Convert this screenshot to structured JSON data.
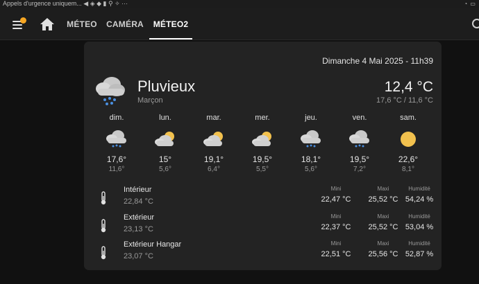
{
  "statusbar": {
    "text": "Appels d'urgence uniquem... ◀ ◈ ◆ ▮ ⚲ ✧ ···",
    "icons": "◔ ▭"
  },
  "nav": {
    "tabs": [
      {
        "label": "MÉTEO"
      },
      {
        "label": "CAMÉRA"
      },
      {
        "label": "MÉTEO2"
      }
    ],
    "active_tab": "MÉTEO2",
    "accent_dot_color": "#f6a623"
  },
  "weather": {
    "datetime": "Dimanche 4 Mai 2025 - 11h39",
    "condition": "Pluvieux",
    "location": "Marçon",
    "temperature": "12,4 °C",
    "range": "17,6 °C / 11,6 °C",
    "icon": "rainy-icon"
  },
  "forecast": [
    {
      "day": "dim.",
      "high": "17,6°",
      "low": "11,6°",
      "icon": "rainy-icon"
    },
    {
      "day": "lun.",
      "high": "15°",
      "low": "5,6°",
      "icon": "partly-cloudy-icon"
    },
    {
      "day": "mar.",
      "high": "19,1°",
      "low": "6,4°",
      "icon": "partly-cloudy-icon"
    },
    {
      "day": "mer.",
      "high": "19,5°",
      "low": "5,5°",
      "icon": "partly-cloudy-icon"
    },
    {
      "day": "jeu.",
      "high": "18,1°",
      "low": "5,6°",
      "icon": "rainy-icon"
    },
    {
      "day": "ven.",
      "high": "19,5°",
      "low": "7,2°",
      "icon": "rainy-icon"
    },
    {
      "day": "sam.",
      "high": "22,6°",
      "low": "8,1°",
      "icon": "sunny-icon"
    }
  ],
  "sensors": {
    "labels": {
      "min": "Mini",
      "max": "Maxi",
      "humidity": "Humidité"
    },
    "items": [
      {
        "name": "Intérieur",
        "value": "22,84 °C",
        "min": "22,47 °C",
        "max": "25,52 °C",
        "humidity": "54,24 %"
      },
      {
        "name": "Extérieur",
        "value": "23,13 °C",
        "min": "22,37 °C",
        "max": "25,52 °C",
        "humidity": "53,04 %"
      },
      {
        "name": "Extérieur Hangar",
        "value": "23,07 °C",
        "min": "22,51 °C",
        "max": "25,56 °C",
        "humidity": "52,87 %"
      }
    ]
  }
}
